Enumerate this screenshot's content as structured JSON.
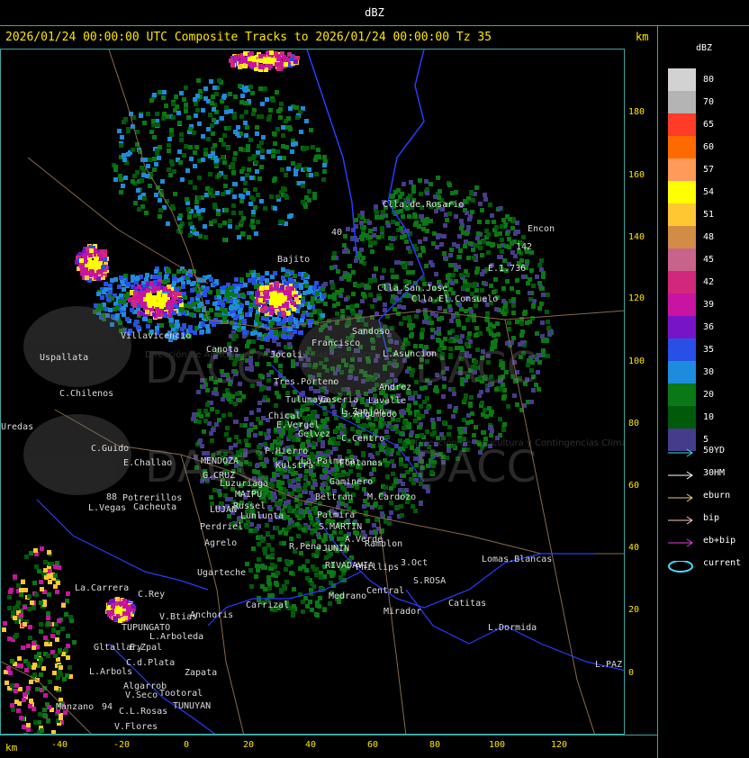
{
  "window": {
    "title": "dBZ"
  },
  "header": {
    "title": "2026/01/24 00:00:00 UTC Composite Tracks to 2026/01/24 00:00:00 Tz 35",
    "units": "km"
  },
  "axes": {
    "x_label": "km",
    "x_ticks": [
      "-40",
      "-20",
      "0",
      "20",
      "40",
      "60",
      "80",
      "100",
      "120"
    ],
    "y_ticks": [
      "180",
      "160",
      "140",
      "120",
      "100",
      "80",
      "60",
      "40",
      "20",
      "0"
    ]
  },
  "legend": {
    "title": "dBZ",
    "levels": [
      {
        "label": "80",
        "color": "#d2d2d2"
      },
      {
        "label": "70",
        "color": "#b4b4b4"
      },
      {
        "label": "65",
        "color": "#ff3c28"
      },
      {
        "label": "60",
        "color": "#ff6a00"
      },
      {
        "label": "57",
        "color": "#ff9a5a"
      },
      {
        "label": "54",
        "color": "#ffff00"
      },
      {
        "label": "51",
        "color": "#ffc832"
      },
      {
        "label": "48",
        "color": "#d28c46"
      },
      {
        "label": "45",
        "color": "#c8648c"
      },
      {
        "label": "42",
        "color": "#d2287c"
      },
      {
        "label": "39",
        "color": "#c814a0"
      },
      {
        "label": "36",
        "color": "#7814c8"
      },
      {
        "label": "35",
        "color": "#2850e6"
      },
      {
        "label": "30",
        "color": "#1e8cdc"
      },
      {
        "label": "20",
        "color": "#0a7814"
      },
      {
        "label": "10",
        "color": "#005a0a"
      },
      {
        "label": "5",
        "color": "#463c8c"
      }
    ],
    "tracks": [
      {
        "label": "50YD",
        "color": "#40e0e0"
      },
      {
        "label": "30HM",
        "color": "#ffffff"
      },
      {
        "label": "eburn",
        "color": "#f0c878"
      },
      {
        "label": "bip",
        "color": "#ffc8c8"
      },
      {
        "label": "eb+bip",
        "color": "#e040e0"
      },
      {
        "label": "current",
        "color": "#40e0ff"
      }
    ]
  },
  "watermarks": [
    "DACC",
    "Dirección de Agricultura y Contingencias Climáticas"
  ],
  "places": [
    "Clla.de.Rosario",
    "Encon",
    "E.1.736",
    "142",
    "Clla.San.Jose",
    "Clla.El.Consuelo",
    "Bajito",
    "Villavicencio",
    "Canota",
    "Jocoli",
    "Francisco",
    "Sandoso",
    "L.Asuncion",
    "Uspallata",
    "Tres.Porteno",
    "Andrez",
    "C.Chilenos",
    "Tulumaya",
    "Caseria",
    "Lavalle",
    "Uredas",
    "Chical",
    "E.Vergel",
    "Gelvez",
    "C.Centro",
    "J.Argumedo",
    "L.Zanjon",
    "C.Guido",
    "E.Challao",
    "MENDOZA",
    "P.Hierro",
    "Kulstra",
    "Fontanas",
    "G.CRUZ",
    "Luzuriaga",
    "Gaminero",
    "La.Palmera",
    "MAIPU",
    "Russel",
    "Beltran",
    "M.Cardozo",
    "Potrerillos",
    "L.Vegas",
    "Cacheuta",
    "LUJAN",
    "Lunlunta",
    "Palmira",
    "Perdriel",
    "S.MARTIN",
    "Agrelo",
    "A.Verde",
    "Ramblon",
    "R.Pena",
    "JUNIN",
    "Ugarteche",
    "RIVADAVIA",
    "Phillips",
    "3.Oct",
    "Lomas.Blancas",
    "La.Carrera",
    "C.Rey",
    "Carrizal",
    "Medrano",
    "Central",
    "S.ROSA",
    "Catitas",
    "TUPUNGATO",
    "V.Btias",
    "Anchoris",
    "Mirador",
    "L.Dormida",
    "Gltallary",
    "E.Zpal",
    "L.Arboleda",
    "L.Arbols",
    "C.d.Plata",
    "Zapata",
    "Algarrob",
    "V.Seco",
    "Tootoral",
    "L.PAZ",
    "Manzano",
    "TUNUYAN",
    "C.L.Rosas",
    "V.Flores",
    "94",
    "88",
    "40"
  ]
}
